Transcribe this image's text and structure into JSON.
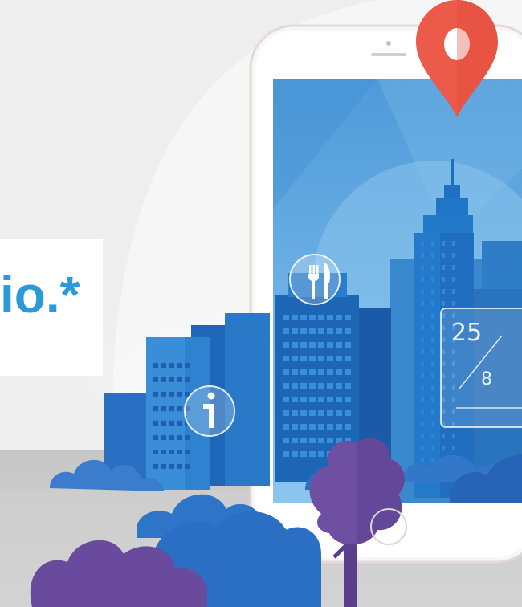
{
  "caption": {
    "text": "io.*",
    "color": "#2a9ad8"
  },
  "date_widget": {
    "day": "25",
    "month": "8"
  },
  "icons": [
    "location-pin-icon",
    "fork-knife-icon",
    "info-icon"
  ],
  "colors": {
    "pin": "#ee5b4b",
    "sky": "#5aa4de",
    "building_dark": "#1a62b4",
    "building_light": "#2f86d2",
    "tree": "#6e4fa2",
    "cloud": "#3a78c8",
    "road": "#c9c9c9"
  }
}
